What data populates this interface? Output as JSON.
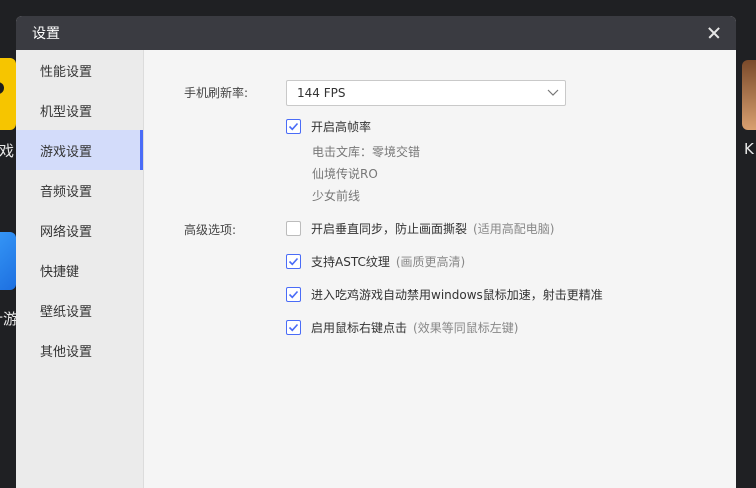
{
  "background": {
    "left_text_1": "游戏",
    "left_text_2": "计游",
    "right_text": "K"
  },
  "dialog": {
    "title": "设置"
  },
  "sidebar": {
    "items": [
      {
        "label": "性能设置"
      },
      {
        "label": "机型设置"
      },
      {
        "label": "游戏设置",
        "active": true
      },
      {
        "label": "音频设置"
      },
      {
        "label": "网络设置"
      },
      {
        "label": "快捷键"
      },
      {
        "label": "壁纸设置"
      },
      {
        "label": "其他设置"
      }
    ]
  },
  "main": {
    "refresh_label": "手机刷新率:",
    "refresh_value": "144 FPS",
    "high_fps": {
      "label": "开启高帧率",
      "checked": true
    },
    "games": [
      "电击文库：零境交错",
      "仙境传说RO",
      "少女前线"
    ],
    "advanced_label": "高级选项:",
    "options": [
      {
        "label": "开启垂直同步，防止画面撕裂",
        "hint": "(适用高配电脑)",
        "checked": false
      },
      {
        "label": "支持ASTC纹理",
        "hint": "(画质更高清)",
        "checked": true
      },
      {
        "label": "进入吃鸡游戏自动禁用windows鼠标加速，射击更精准",
        "hint": "",
        "checked": true
      },
      {
        "label": "启用鼠标右键点击",
        "hint": "(效果等同鼠标左键)",
        "checked": true
      }
    ]
  },
  "colors": {
    "accent": "#4a6cf7",
    "titlebar": "#3a3b41",
    "active_nav": "#d3dcfa"
  }
}
